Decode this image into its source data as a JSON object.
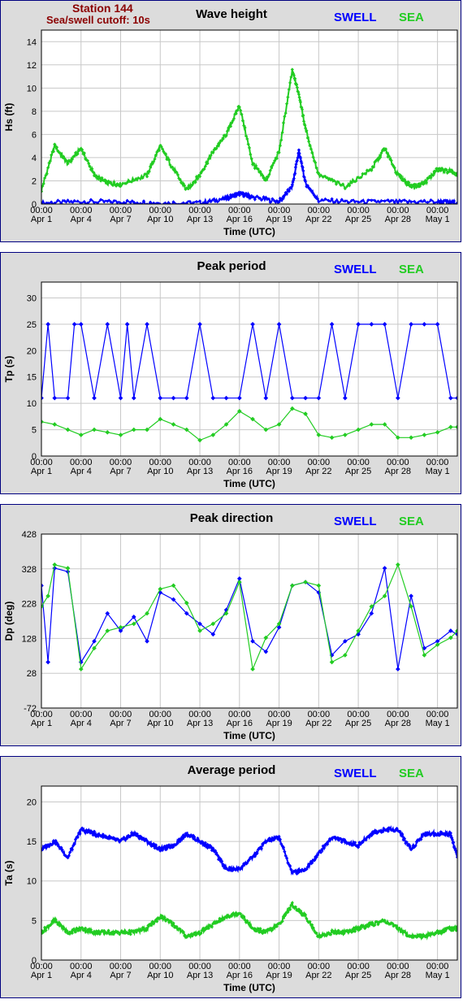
{
  "header": {
    "station": "Station 144",
    "cutoff": "Sea/swell cutoff: 10s"
  },
  "legend": {
    "swell": "SWELL",
    "sea": "SEA"
  },
  "colors": {
    "swell": "#0000ff",
    "sea": "#22cc22",
    "frame": "#000080",
    "panel_bg": "#dcdcdc"
  },
  "time_axis": {
    "label": "Time (UTC)",
    "ticks": [
      {
        "time": "00:00",
        "date": "Apr 1"
      },
      {
        "time": "00:00",
        "date": "Apr 4"
      },
      {
        "time": "00:00",
        "date": "Apr 7"
      },
      {
        "time": "00:00",
        "date": "Apr 10"
      },
      {
        "time": "00:00",
        "date": "Apr 13"
      },
      {
        "time": "00:00",
        "date": "Apr 16"
      },
      {
        "time": "00:00",
        "date": "Apr 19"
      },
      {
        "time": "00:00",
        "date": "Apr 22"
      },
      {
        "time": "00:00",
        "date": "Apr 25"
      },
      {
        "time": "00:00",
        "date": "Apr 28"
      },
      {
        "time": "00:00",
        "date": "May 1"
      }
    ]
  },
  "chart_data": [
    {
      "type": "line",
      "title": "Wave height",
      "xlabel": "Time (UTC)",
      "ylabel": "Hs (ft)",
      "xlim": [
        "2024-04-01 00:00",
        "2024-05-02 12:00"
      ],
      "ylim": [
        0,
        15
      ],
      "yticks": [
        0,
        2,
        4,
        6,
        8,
        10,
        12,
        14
      ],
      "grid": true,
      "series": [
        {
          "name": "SWELL",
          "x": [
            "2024-04-01",
            "2024-04-04",
            "2024-04-07",
            "2024-04-10",
            "2024-04-13",
            "2024-04-15",
            "2024-04-16",
            "2024-04-17",
            "2024-04-19",
            "2024-04-20",
            "2024-04-20 12:00",
            "2024-04-21",
            "2024-04-22",
            "2024-04-25",
            "2024-04-28",
            "2024-05-01",
            "2024-05-02 12:00"
          ],
          "values": [
            0.1,
            0.2,
            0.2,
            0.1,
            0.1,
            0.5,
            0.9,
            0.6,
            0.2,
            1.5,
            4.6,
            1.8,
            0.3,
            0.2,
            0.2,
            0.2,
            0.1
          ]
        },
        {
          "name": "SEA",
          "x": [
            "2024-04-01",
            "2024-04-02",
            "2024-04-03",
            "2024-04-04",
            "2024-04-05",
            "2024-04-06",
            "2024-04-07",
            "2024-04-09",
            "2024-04-10",
            "2024-04-11",
            "2024-04-12",
            "2024-04-13",
            "2024-04-14",
            "2024-04-15",
            "2024-04-16",
            "2024-04-17",
            "2024-04-18",
            "2024-04-19",
            "2024-04-20",
            "2024-04-20 12:00",
            "2024-04-21",
            "2024-04-22",
            "2024-04-24",
            "2024-04-26",
            "2024-04-27",
            "2024-04-28",
            "2024-04-29",
            "2024-04-30",
            "2024-05-01",
            "2024-05-02",
            "2024-05-02 12:00"
          ],
          "values": [
            1.2,
            5.0,
            3.5,
            4.8,
            2.5,
            1.8,
            1.7,
            2.5,
            5.0,
            3.0,
            1.2,
            2.5,
            4.5,
            6.0,
            8.5,
            3.5,
            2.0,
            4.5,
            11.5,
            9.5,
            6.5,
            2.5,
            1.5,
            3.0,
            4.8,
            2.5,
            1.5,
            1.8,
            3.0,
            2.8,
            2.5
          ]
        }
      ]
    },
    {
      "type": "scatter",
      "title": "Peak period",
      "xlabel": "Time (UTC)",
      "ylabel": "Tp (s)",
      "xlim": [
        "2024-04-01 00:00",
        "2024-05-02 12:00"
      ],
      "ylim": [
        0,
        33
      ],
      "yticks": [
        0,
        5,
        10,
        15,
        20,
        25,
        30
      ],
      "grid": true,
      "series": [
        {
          "name": "SWELL",
          "x": [
            "2024-04-01",
            "2024-04-01 12:00",
            "2024-04-02",
            "2024-04-03",
            "2024-04-03 12:00",
            "2024-04-04",
            "2024-04-05",
            "2024-04-06",
            "2024-04-07",
            "2024-04-07 12:00",
            "2024-04-08",
            "2024-04-09",
            "2024-04-10",
            "2024-04-11",
            "2024-04-12",
            "2024-04-13",
            "2024-04-14",
            "2024-04-15",
            "2024-04-16",
            "2024-04-17",
            "2024-04-18",
            "2024-04-19",
            "2024-04-20",
            "2024-04-21",
            "2024-04-22",
            "2024-04-23",
            "2024-04-24",
            "2024-04-25",
            "2024-04-26",
            "2024-04-27",
            "2024-04-28",
            "2024-04-29",
            "2024-04-30",
            "2024-05-01",
            "2024-05-02",
            "2024-05-02 12:00"
          ],
          "values": [
            11,
            25,
            11,
            11,
            25,
            25,
            11,
            25,
            11,
            25,
            11,
            25,
            11,
            11,
            11,
            25,
            11,
            11,
            11,
            25,
            11,
            25,
            11,
            11,
            11,
            25,
            11,
            25,
            25,
            25,
            11,
            25,
            25,
            25,
            11,
            11
          ]
        },
        {
          "name": "SEA",
          "x": [
            "2024-04-01",
            "2024-04-02",
            "2024-04-03",
            "2024-04-04",
            "2024-04-05",
            "2024-04-06",
            "2024-04-07",
            "2024-04-08",
            "2024-04-09",
            "2024-04-10",
            "2024-04-11",
            "2024-04-12",
            "2024-04-13",
            "2024-04-14",
            "2024-04-15",
            "2024-04-16",
            "2024-04-17",
            "2024-04-18",
            "2024-04-19",
            "2024-04-20",
            "2024-04-21",
            "2024-04-22",
            "2024-04-23",
            "2024-04-24",
            "2024-04-25",
            "2024-04-26",
            "2024-04-27",
            "2024-04-28",
            "2024-04-29",
            "2024-04-30",
            "2024-05-01",
            "2024-05-02",
            "2024-05-02 12:00"
          ],
          "values": [
            6.5,
            6,
            5,
            4,
            5,
            4.5,
            4,
            5,
            5,
            7,
            6,
            5,
            3,
            4,
            6,
            8.5,
            7,
            5,
            6,
            9,
            8,
            4,
            3.5,
            4,
            5,
            6,
            6,
            3.5,
            3.5,
            4,
            4.5,
            5.5,
            5.5
          ]
        }
      ]
    },
    {
      "type": "scatter",
      "title": "Peak direction",
      "xlabel": "Time (UTC)",
      "ylabel": "Dp (deg)",
      "xlim": [
        "2024-04-01 00:00",
        "2024-05-02 12:00"
      ],
      "ylim": [
        -72,
        428
      ],
      "yticks": [
        -72,
        28,
        128,
        228,
        328,
        428
      ],
      "grid": true,
      "series": [
        {
          "name": "SWELL",
          "x": [
            "2024-04-01",
            "2024-04-01 12:00",
            "2024-04-02",
            "2024-04-03",
            "2024-04-04",
            "2024-04-05",
            "2024-04-06",
            "2024-04-07",
            "2024-04-08",
            "2024-04-09",
            "2024-04-10",
            "2024-04-11",
            "2024-04-12",
            "2024-04-13",
            "2024-04-14",
            "2024-04-15",
            "2024-04-16",
            "2024-04-17",
            "2024-04-18",
            "2024-04-19",
            "2024-04-20",
            "2024-04-21",
            "2024-04-22",
            "2024-04-23",
            "2024-04-24",
            "2024-04-25",
            "2024-04-26",
            "2024-04-27",
            "2024-04-28",
            "2024-04-29",
            "2024-04-30",
            "2024-05-01",
            "2024-05-02",
            "2024-05-02 12:00"
          ],
          "values": [
            280,
            60,
            330,
            320,
            60,
            120,
            200,
            150,
            190,
            120,
            260,
            240,
            200,
            170,
            140,
            210,
            300,
            120,
            90,
            160,
            280,
            290,
            260,
            80,
            120,
            140,
            200,
            330,
            40,
            250,
            100,
            120,
            150,
            140
          ]
        },
        {
          "name": "SEA",
          "x": [
            "2024-04-01",
            "2024-04-01 12:00",
            "2024-04-02",
            "2024-04-03",
            "2024-04-04",
            "2024-04-05",
            "2024-04-06",
            "2024-04-07",
            "2024-04-08",
            "2024-04-09",
            "2024-04-10",
            "2024-04-11",
            "2024-04-12",
            "2024-04-13",
            "2024-04-14",
            "2024-04-15",
            "2024-04-16",
            "2024-04-17",
            "2024-04-18",
            "2024-04-19",
            "2024-04-20",
            "2024-04-21",
            "2024-04-22",
            "2024-04-23",
            "2024-04-24",
            "2024-04-25",
            "2024-04-26",
            "2024-04-27",
            "2024-04-28",
            "2024-04-29",
            "2024-04-30",
            "2024-05-01",
            "2024-05-02",
            "2024-05-02 12:00"
          ],
          "values": [
            220,
            250,
            340,
            330,
            40,
            100,
            150,
            160,
            170,
            200,
            270,
            280,
            230,
            150,
            170,
            200,
            290,
            40,
            130,
            170,
            280,
            290,
            280,
            60,
            80,
            150,
            220,
            250,
            340,
            220,
            80,
            110,
            130,
            150
          ]
        }
      ]
    },
    {
      "type": "line",
      "title": "Average period",
      "xlabel": "Time (UTC)",
      "ylabel": "Ta (s)",
      "xlim": [
        "2024-04-01 00:00",
        "2024-05-02 12:00"
      ],
      "ylim": [
        0,
        22
      ],
      "yticks": [
        0,
        5,
        10,
        15,
        20
      ],
      "grid": true,
      "series": [
        {
          "name": "SWELL",
          "x": [
            "2024-04-01",
            "2024-04-02",
            "2024-04-03",
            "2024-04-04",
            "2024-04-05",
            "2024-04-06",
            "2024-04-07",
            "2024-04-08",
            "2024-04-09",
            "2024-04-10",
            "2024-04-11",
            "2024-04-12",
            "2024-04-13",
            "2024-04-14",
            "2024-04-15",
            "2024-04-16",
            "2024-04-17",
            "2024-04-18",
            "2024-04-19",
            "2024-04-20",
            "2024-04-21",
            "2024-04-22",
            "2024-04-23",
            "2024-04-24",
            "2024-04-25",
            "2024-04-26",
            "2024-04-27",
            "2024-04-28",
            "2024-04-29",
            "2024-04-30",
            "2024-05-01",
            "2024-05-02",
            "2024-05-02 12:00"
          ],
          "values": [
            14,
            15,
            13,
            16.5,
            16,
            15.5,
            15,
            16,
            15,
            14,
            14.5,
            16,
            15,
            14,
            11.5,
            11.5,
            13,
            15,
            15.5,
            11,
            11.5,
            13.5,
            15.5,
            15,
            14.5,
            16,
            16.5,
            16.5,
            14,
            16,
            16,
            16,
            13
          ]
        },
        {
          "name": "SEA",
          "x": [
            "2024-04-01",
            "2024-04-02",
            "2024-04-03",
            "2024-04-04",
            "2024-04-05",
            "2024-04-06",
            "2024-04-07",
            "2024-04-08",
            "2024-04-09",
            "2024-04-10",
            "2024-04-11",
            "2024-04-12",
            "2024-04-13",
            "2024-04-14",
            "2024-04-15",
            "2024-04-16",
            "2024-04-17",
            "2024-04-18",
            "2024-04-19",
            "2024-04-20",
            "2024-04-21",
            "2024-04-22",
            "2024-04-23",
            "2024-04-24",
            "2024-04-25",
            "2024-04-26",
            "2024-04-27",
            "2024-04-28",
            "2024-04-29",
            "2024-04-30",
            "2024-05-01",
            "2024-05-02",
            "2024-05-02 12:00"
          ],
          "values": [
            3.5,
            5,
            3.5,
            4,
            3.5,
            3.5,
            3.5,
            3.5,
            4,
            5.5,
            4.5,
            3,
            3.5,
            4.5,
            5.5,
            6,
            4,
            3.5,
            4.5,
            7,
            5.5,
            3,
            3.5,
            3.5,
            4,
            4.5,
            5,
            4,
            3,
            3,
            3.5,
            4,
            4
          ]
        }
      ]
    }
  ]
}
